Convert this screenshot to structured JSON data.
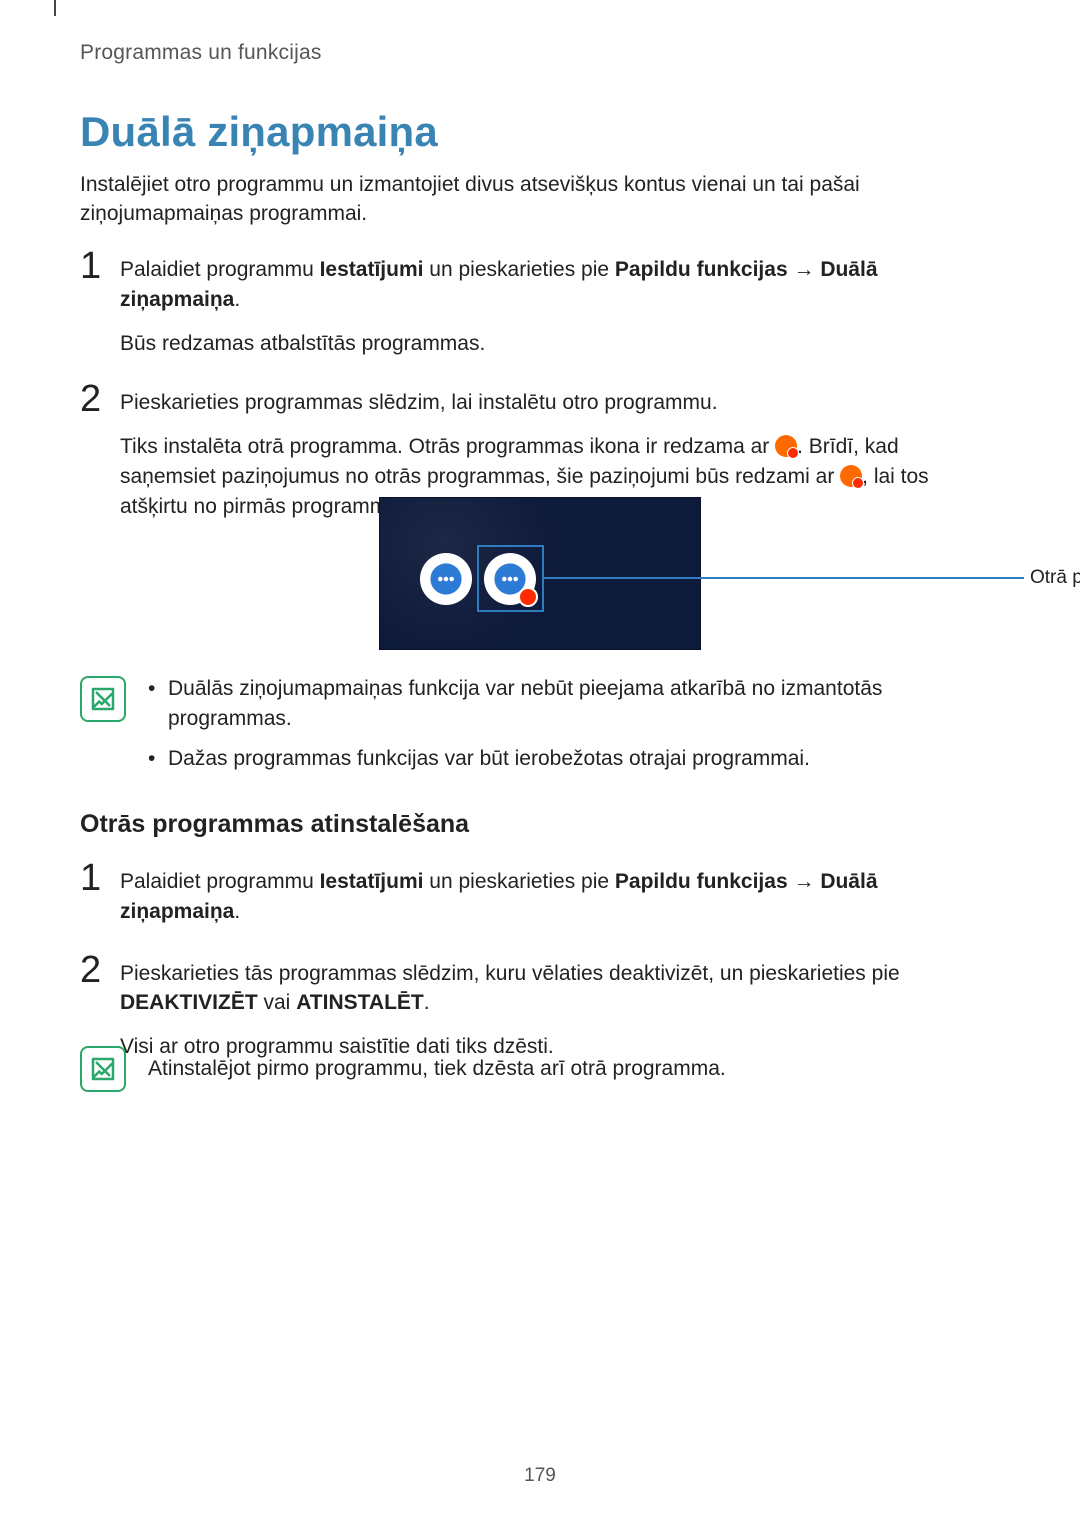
{
  "section_header": "Programmas un funkcijas",
  "title": "Duālā ziņapmaiņa",
  "intro": "Instalējiet otro programmu un izmantojiet divus atsevišķus kontus vienai un tai pašai ziņojumapmaiņas programmai.",
  "steps_a": {
    "s1": {
      "pre": "Palaidiet programmu ",
      "bold1": "Iestatījumi",
      "mid": " un pieskarieties pie ",
      "bold2": "Papildu funkcijas",
      "arrow": " → ",
      "bold3": "Duālā ziņapmaiņa",
      "period": ".",
      "sub": "Būs redzamas atbalstītās programmas."
    },
    "s2": {
      "line1": "Pieskarieties programmas slēdzim, lai instalētu otro programmu.",
      "line2_a": "Tiks instalēta otrā programma. Otrās programmas ikona ir redzama ar ",
      "line2_b": ". Brīdī, kad saņemsiet paziņojumus no otrās programmas, šie paziņojumi būs redzami ar ",
      "line2_c": ", lai tos atšķirtu no pirmās programmas paziņojumiem."
    }
  },
  "figure": {
    "label": "Otrā programma"
  },
  "notes_a": {
    "n1": "Duālās ziņojumapmaiņas funkcija var nebūt pieejama atkarībā no izmantotās programmas.",
    "n2": "Dažas programmas funkcijas var būt ierobežotas otrajai programmai."
  },
  "subheading": "Otrās programmas atinstalēšana",
  "steps_b": {
    "s1": {
      "pre": "Palaidiet programmu ",
      "bold1": "Iestatījumi",
      "mid": " un pieskarieties pie ",
      "bold2": "Papildu funkcijas",
      "arrow": " → ",
      "bold3": "Duālā ziņapmaiņa",
      "period": "."
    },
    "s2": {
      "line1_a": "Pieskarieties tās programmas slēdzim, kuru vēlaties deaktivizēt, un pieskarieties pie ",
      "bold1": "DEAKTIVIZĒT",
      "or": " vai ",
      "bold2": "ATINSTALĒT",
      "period": ".",
      "sub": "Visi ar otro programmu saistītie dati tiks dzēsti."
    }
  },
  "note_b": "Atinstalējot pirmo programmu, tiek dzēsta arī otrā programma.",
  "page_number": "179"
}
